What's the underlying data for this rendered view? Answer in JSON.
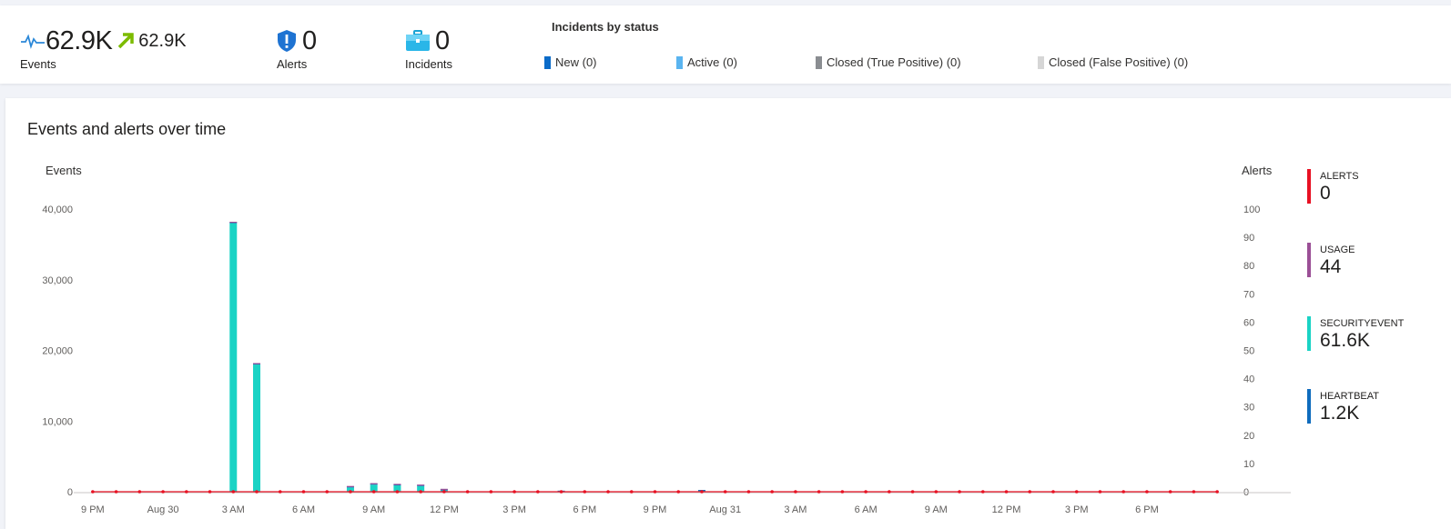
{
  "summary": {
    "events": {
      "value": "62.9K",
      "trend_value": "62.9K",
      "label": "Events"
    },
    "alerts": {
      "value": "0",
      "label": "Alerts"
    },
    "incidents": {
      "value": "0",
      "label": "Incidents"
    },
    "incidents_by_status": {
      "title": "Incidents by status",
      "items": [
        {
          "label": "New (0)",
          "color": "#0b6bc8"
        },
        {
          "label": "Active (0)",
          "color": "#5ab4f0"
        },
        {
          "label": "Closed (True Positive) (0)",
          "color": "#8a8d91"
        },
        {
          "label": "Closed (False Positive) (0)",
          "color": "#d6d6d6"
        }
      ]
    }
  },
  "panel": {
    "title": "Events and alerts over time"
  },
  "chart_data": {
    "type": "bar",
    "title": "Events and alerts over time",
    "ylabel": "Events",
    "y2label": "Alerts",
    "ylim": [
      0,
      40000
    ],
    "y2lim": [
      0,
      100
    ],
    "yticks": [
      "40,000",
      "30,000",
      "20,000",
      "10,000",
      "0"
    ],
    "y2ticks": [
      "100",
      "90",
      "80",
      "70",
      "60",
      "50",
      "40",
      "30",
      "20",
      "10",
      "0"
    ],
    "xticks": [
      "9 PM",
      "Aug 30",
      "3 AM",
      "6 AM",
      "9 AM",
      "12 PM",
      "3 PM",
      "6 PM",
      "9 PM",
      "Aug 31",
      "3 AM",
      "6 AM",
      "9 AM",
      "12 PM",
      "3 PM",
      "6 PM"
    ],
    "num_slots": 49,
    "series": [
      {
        "name": "SECURITYEVENT",
        "color": "#1ad3c5",
        "points": [
          [
            6,
            38000
          ],
          [
            7,
            18000
          ],
          [
            11,
            600
          ],
          [
            12,
            1000
          ],
          [
            13,
            900
          ],
          [
            14,
            800
          ],
          [
            15,
            200
          ],
          [
            26,
            100
          ]
        ]
      },
      {
        "name": "HEARTBEAT",
        "color": "#0f6cbd",
        "points": [
          [
            6,
            50
          ],
          [
            7,
            50
          ],
          [
            11,
            60
          ],
          [
            12,
            60
          ],
          [
            13,
            60
          ],
          [
            14,
            60
          ],
          [
            15,
            60
          ],
          [
            20,
            30
          ],
          [
            26,
            60
          ]
        ]
      },
      {
        "name": "USAGE",
        "color": "#9b4f96",
        "points": [
          [
            6,
            10
          ],
          [
            7,
            10
          ],
          [
            11,
            10
          ],
          [
            12,
            10
          ],
          [
            13,
            10
          ],
          [
            14,
            10
          ],
          [
            15,
            10
          ]
        ]
      }
    ],
    "alerts_series": {
      "name": "ALERTS",
      "color": "#e81123",
      "value": 0
    },
    "legend": [
      {
        "name": "ALERTS",
        "value": "0",
        "color": "#e81123"
      },
      {
        "name": "USAGE",
        "value": "44",
        "color": "#9b4f96"
      },
      {
        "name": "SECURITYEVENT",
        "value": "61.6K",
        "color": "#1ad3c5"
      },
      {
        "name": "HEARTBEAT",
        "value": "1.2K",
        "color": "#0f6cbd"
      }
    ],
    "legend_position": "right"
  }
}
